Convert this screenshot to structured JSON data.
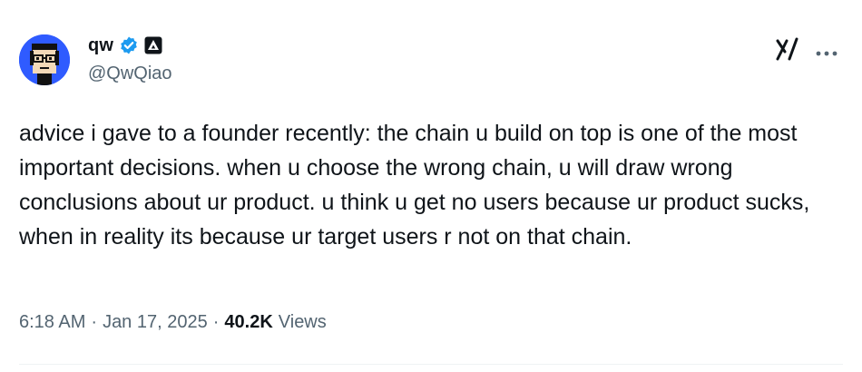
{
  "author": {
    "display_name": "qw",
    "handle": "@QwQiao",
    "avatar_icon": "pixel-face-avatar",
    "verified_icon": "verified-badge-icon",
    "affiliation_icon": "affiliate-triangle-icon"
  },
  "header_actions": {
    "grok_icon": "grok-icon",
    "more_icon": "more-icon"
  },
  "tweet": {
    "text": "advice i gave to a founder recently: the chain u build on top is one of the most important decisions. when u choose the wrong chain, u will draw wrong conclusions about ur product. u think u get no users because ur product sucks, when in reality its because ur target users r not on that chain."
  },
  "meta": {
    "time": "6:18 AM",
    "separator": "·",
    "date": "Jan 17, 2025",
    "views_count": "40.2K",
    "views_label": "Views"
  },
  "colors": {
    "text_primary": "#0f1419",
    "text_secondary": "#536471",
    "verified_blue": "#1d9bf0",
    "avatar_bg": "#2f5bff"
  }
}
